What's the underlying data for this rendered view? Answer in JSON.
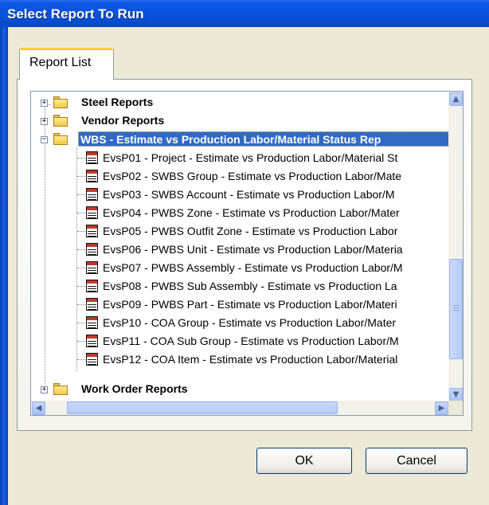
{
  "window": {
    "title": "Select Report To Run"
  },
  "tabs": [
    {
      "label": "Report List"
    }
  ],
  "tree": {
    "top_items": [
      {
        "label": "Steel Reports",
        "expander": "+"
      },
      {
        "label": "Vendor Reports",
        "expander": "+"
      }
    ],
    "selected_item": {
      "label": "WBS - Estimate vs Production Labor/Material Status Rep",
      "expander": "−"
    },
    "children": [
      "EvsP01 - Project - Estimate vs Production Labor/Material St",
      "EvsP02 - SWBS Group - Estimate vs Production Labor/Mate",
      "EvsP03 - SWBS Account - Estimate vs Production Labor/M",
      "EvsP04 - PWBS Zone - Estimate vs Production Labor/Mater",
      "EvsP05 - PWBS Outfit Zone - Estimate vs Production Labor",
      "EvsP06 - PWBS Unit - Estimate vs Production Labor/Materia",
      "EvsP07 - PWBS Assembly - Estimate vs Production Labor/M",
      "EvsP08 - PWBS Sub Assembly - Estimate vs Production La",
      "EvsP09 - PWBS Part - Estimate vs Production Labor/Materi",
      "EvsP10 - COA Group - Estimate vs Production Labor/Mater",
      "EvsP11 - COA Sub Group - Estimate vs Production Labor/M",
      "EvsP12 - COA Item - Estimate vs Production Labor/Material"
    ],
    "bottom_item": {
      "label": "Work Order Reports",
      "expander": "+"
    }
  },
  "buttons": {
    "ok": "OK",
    "cancel": "Cancel"
  },
  "icons": {
    "folder": "folder-icon",
    "report": "report-icon",
    "scroll_up": "▲",
    "scroll_down": "▼",
    "scroll_left": "◀",
    "scroll_right": "▶"
  }
}
